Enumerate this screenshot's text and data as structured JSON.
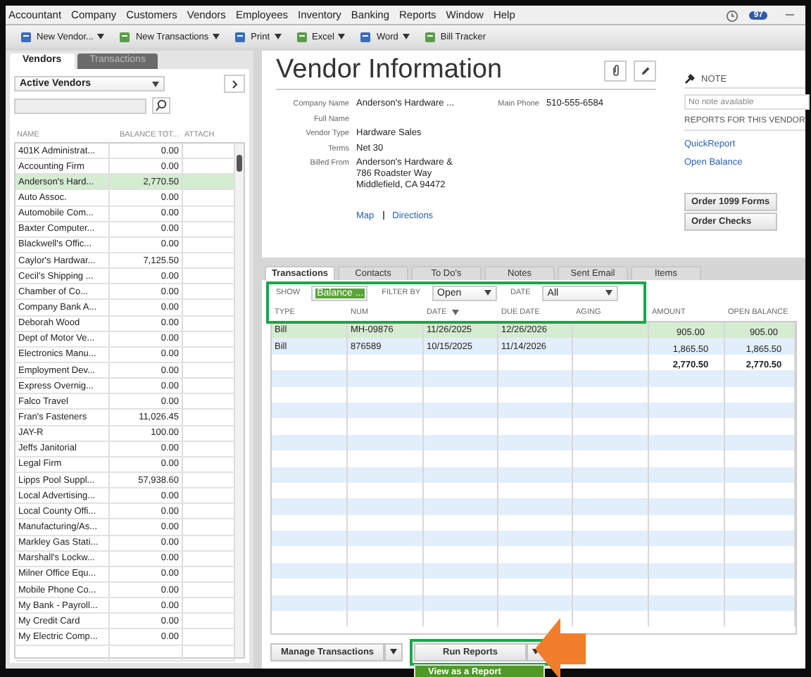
{
  "menu_bar": [
    "Accountant",
    "Company",
    "Customers",
    "Vendors",
    "Employees",
    "Inventory",
    "Banking",
    "Reports",
    "Window",
    "Help"
  ],
  "menu_badge": "97",
  "toolbar": [
    {
      "label": "New Vendor...",
      "dropdown": true
    },
    {
      "label": "New Transactions",
      "dropdown": true
    },
    {
      "label": "Print",
      "dropdown": true
    },
    {
      "label": "Excel",
      "dropdown": true
    },
    {
      "label": "Word",
      "dropdown": true
    },
    {
      "label": "Bill Tracker",
      "dropdown": false
    }
  ],
  "left_tabs": [
    {
      "label": "Vendors",
      "selected": true
    },
    {
      "label": "Transactions",
      "selected": false
    }
  ],
  "vendor_filter": "Active Vendors",
  "vendor_columns": [
    "NAME",
    "BALANCE TOT...",
    "ATTACH"
  ],
  "vendors": [
    {
      "name": "401K Administrat...",
      "balance": "0.00",
      "selected": false
    },
    {
      "name": "Accounting Firm",
      "balance": "0.00",
      "selected": false
    },
    {
      "name": "Anderson's Hard...",
      "balance": "2,770.50",
      "selected": true
    },
    {
      "name": "Auto Assoc.",
      "balance": "0.00",
      "selected": false
    },
    {
      "name": "Automobile Com...",
      "balance": "0.00",
      "selected": false
    },
    {
      "name": "Baxter Computer...",
      "balance": "0.00",
      "selected": false
    },
    {
      "name": "Blackwell's Offic...",
      "balance": "0.00",
      "selected": false
    },
    {
      "name": "Caylor's Hardwar...",
      "balance": "7,125.50",
      "selected": false
    },
    {
      "name": "Cecil's Shipping ...",
      "balance": "0.00",
      "selected": false
    },
    {
      "name": "Chamber of Co...",
      "balance": "0.00",
      "selected": false
    },
    {
      "name": "Company Bank A...",
      "balance": "0.00",
      "selected": false
    },
    {
      "name": "Deborah Wood",
      "balance": "0.00",
      "selected": false
    },
    {
      "name": "Dept of Motor Ve...",
      "balance": "0.00",
      "selected": false
    },
    {
      "name": "Electronics Manu...",
      "balance": "0.00",
      "selected": false
    },
    {
      "name": "Employment Dev...",
      "balance": "0.00",
      "selected": false
    },
    {
      "name": "Express Overnig...",
      "balance": "0.00",
      "selected": false
    },
    {
      "name": "Falco Travel",
      "balance": "0.00",
      "selected": false
    },
    {
      "name": "Fran's Fasteners",
      "balance": "11,026.45",
      "selected": false
    },
    {
      "name": "JAY-R",
      "balance": "100.00",
      "selected": false
    },
    {
      "name": "Jeffs Janitorial",
      "balance": "0.00",
      "selected": false
    },
    {
      "name": "Legal Firm",
      "balance": "0.00",
      "selected": false
    },
    {
      "name": "Lipps Pool Suppl...",
      "balance": "57,938.60",
      "selected": false
    },
    {
      "name": "Local Advertising...",
      "balance": "0.00",
      "selected": false
    },
    {
      "name": "Local County Offi...",
      "balance": "0.00",
      "selected": false
    },
    {
      "name": "Manufacturing/As...",
      "balance": "0.00",
      "selected": false
    },
    {
      "name": "Markley Gas Stati...",
      "balance": "0.00",
      "selected": false
    },
    {
      "name": "Marshall's Lockw...",
      "balance": "0.00",
      "selected": false
    },
    {
      "name": "Milner Office Equ...",
      "balance": "0.00",
      "selected": false
    },
    {
      "name": "Mobile Phone Co...",
      "balance": "0.00",
      "selected": false
    },
    {
      "name": "My Bank - Payroll...",
      "balance": "0.00",
      "selected": false
    },
    {
      "name": "My Credit Card",
      "balance": "0.00",
      "selected": false
    },
    {
      "name": "My Electric Comp...",
      "balance": "0.00",
      "selected": false
    }
  ],
  "title": "Vendor Information",
  "fields_left": [
    {
      "label": "Company Name",
      "value": "Anderson's Hardware ..."
    },
    {
      "label": "Full Name"
    },
    {
      "label": "Vendor Type",
      "value": "Hardware Sales"
    },
    {
      "label": "Terms",
      "value": "Net 30"
    },
    {
      "label": "Billed From",
      "value": "Anderson's Hardware &\n786 Roadster Way\nMiddlefield, CA 94472"
    }
  ],
  "fields_right": [
    {
      "label": "Main Phone",
      "value": "510-555-6584"
    }
  ],
  "links": [
    "Map",
    "Directions"
  ],
  "note": {
    "heading": "NOTE",
    "placeholder": "No note available"
  },
  "reports_heading": "REPORTS FOR THIS VENDOR",
  "report_links": [
    "QuickReport",
    "Open Balance"
  ],
  "side_buttons": [
    "Order 1099 Forms",
    "Order Checks"
  ],
  "detail_tabs": [
    {
      "label": "Transactions",
      "selected": true
    },
    {
      "label": "Contacts",
      "selected": false
    },
    {
      "label": "To Do's",
      "selected": false
    },
    {
      "label": "Notes",
      "selected": false
    },
    {
      "label": "Sent Email",
      "selected": false
    },
    {
      "label": "Items",
      "selected": false
    }
  ],
  "filters": [
    {
      "label": "SHOW",
      "value": "Balance ...",
      "highlighted": true
    },
    {
      "label": "FILTER BY",
      "value": "Open",
      "highlighted": false
    },
    {
      "label": "DATE",
      "value": "All",
      "highlighted": false
    }
  ],
  "columns": [
    {
      "label": "TYPE",
      "sorted": false
    },
    {
      "label": "NUM",
      "sorted": false
    },
    {
      "label": "DATE",
      "sorted": true
    },
    {
      "label": "DUE DATE",
      "sorted": false
    },
    {
      "label": "AGING",
      "sorted": false
    },
    {
      "label": "AMOUNT",
      "sorted": false
    },
    {
      "label": "OPEN BALANCE",
      "sorted": false
    }
  ],
  "rows": [
    {
      "cells": [
        "Bill",
        "MH-09876",
        "11/26/2025",
        "12/26/2026",
        "",
        "905.00",
        "905.00"
      ],
      "selected": true
    },
    {
      "cells": [
        "Bill",
        "876589",
        "10/15/2025",
        "11/14/2026",
        "",
        "1,865.50",
        "1,865.50"
      ],
      "selected": false
    }
  ],
  "totals": {
    "amount": "2,770.50",
    "open_balance": "2,770.50"
  },
  "bottom_buttons": [
    "Manage Transactions",
    "Run Reports"
  ],
  "report_menu": [
    "View as a Report"
  ]
}
